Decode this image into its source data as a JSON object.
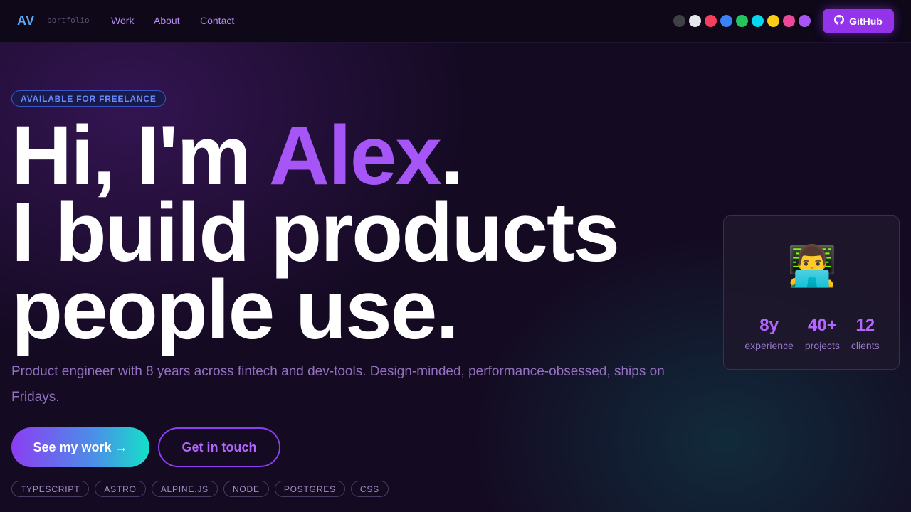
{
  "nav": {
    "logo": "AV",
    "logo_sub": "portfolio",
    "links": [
      "Work",
      "About",
      "Contact"
    ],
    "theme_colors": [
      "#3f3f46",
      "#e5e7eb",
      "#f43f5e",
      "#3b82f6",
      "#22c55e",
      "#06d6f0",
      "#facc15",
      "#ec4899",
      "#a855f7"
    ],
    "active_theme_index": 8,
    "github_label": "GitHub",
    "github_icon": "github-icon"
  },
  "hero": {
    "badge": "AVAILABLE FOR FREELANCE",
    "headline_line1_pre": "Hi, I'm ",
    "headline_name": "Alex",
    "headline_line1_post": ".",
    "headline_line2": "I build products",
    "headline_line3": "people use.",
    "subtext": "Product engineer with 8 years across fintech and dev-tools. Design-minded, performance-obsessed, ships on Fridays.",
    "primary_cta": "See my work →",
    "secondary_cta": "Get in touch",
    "tags": [
      "TYPESCRIPT",
      "ASTRO",
      "ALPINE.JS",
      "NODE",
      "POSTGRES",
      "CSS"
    ]
  },
  "profile_card": {
    "avatar": "👨‍💻",
    "stats": [
      {
        "value": "8y",
        "label": "experience"
      },
      {
        "value": "40+",
        "label": "projects"
      },
      {
        "value": "12",
        "label": "clients"
      }
    ]
  },
  "colors": {
    "accent": "#a655f7",
    "button": "#9333ea",
    "background": "#140a22"
  }
}
